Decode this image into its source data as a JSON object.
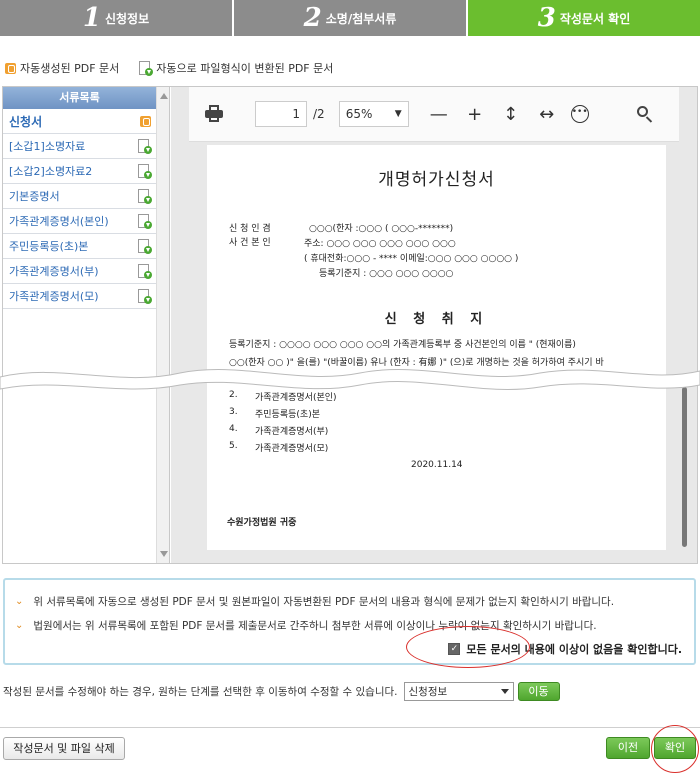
{
  "steps": [
    {
      "num": "1",
      "label": "신청정보"
    },
    {
      "num": "2",
      "label": "소명/첨부서류"
    },
    {
      "num": "3",
      "label": "작성문서 확인"
    }
  ],
  "legend": {
    "auto_pdf": "자동생성된 PDF 문서",
    "converted_pdf": "자동으로 파일형식이 변환된 PDF 문서"
  },
  "doclist": {
    "header": "서류목록",
    "items": [
      {
        "label": "신청서",
        "icon": "pdf-generated-icon"
      },
      {
        "label": "[소갑1]소명자료",
        "icon": "pdf-converted-icon"
      },
      {
        "label": "[소갑2]소명자료2",
        "icon": "pdf-converted-icon"
      },
      {
        "label": "기본증명서",
        "icon": "pdf-converted-icon"
      },
      {
        "label": "가족관계증명서(본인)",
        "icon": "pdf-converted-icon"
      },
      {
        "label": "주민등록등(초)본",
        "icon": "pdf-converted-icon"
      },
      {
        "label": "가족관계증명서(부)",
        "icon": "pdf-converted-icon"
      },
      {
        "label": "가족관계증명서(모)",
        "icon": "pdf-converted-icon"
      }
    ]
  },
  "viewer": {
    "page_current": "1",
    "page_total": "/2",
    "zoom": "65%",
    "doc": {
      "title": "개명허가신청서",
      "applicant_label1": "신 청 인 겸",
      "applicant_label2": "사 건 본 인",
      "line1": "○○○(한자 :○○○ ( ○○○-*******)",
      "line2": "주소: ○○○ ○○○ ○○○ ○○○ ○○○",
      "line3": "( 휴대전화:○○○ - ****   이메일:○○○ ○○○ ○○○○ )",
      "line4": "등록기준지 :  ○○○ ○○○ ○○○○",
      "subtitle": "신 청 취 지",
      "purpose1": "등록기준지 : ○○○○ ○○○ ○○○ ○○의 가족관계등록부 중 사건본인의 이름 \" (현재이름)",
      "purpose2": "○○(한자 ○○ )\" 을(를) \"(바꿀이름) 유나 (한자 : 有娜 )\" (으)로 개명하는 것을 허가하여 주시기 바",
      "list": [
        {
          "n": "2.",
          "t": "가족관계증명서(본인)"
        },
        {
          "n": "3.",
          "t": "주민등록등(초)본"
        },
        {
          "n": "4.",
          "t": "가족관계증명서(부)"
        },
        {
          "n": "5.",
          "t": "가족관계증명서(모)"
        }
      ],
      "date": "2020.11.14",
      "court": "수원가정법원 귀중"
    }
  },
  "notice": {
    "line1": "위 서류목록에 자동으로 생성된 PDF 문서 및 원본파일이 자동변환된 PDF 문서의 내용과 형식에 문제가 없는지 확인하시기 바랍니다.",
    "line2": "법원에서는 위 서류목록에 포함된 PDF 문서를 제출문서로 간주하니 첨부한 서류에 이상이나 누락이 없는지 확인하시기 바랍니다.",
    "agree": "모든 문서의 내용에 이상이 없음을 확인합니다."
  },
  "edit": {
    "text": "작성된 문서를 수정해야 하는 경우, 원하는 단계를 선택한 후 이동하여 수정할 수 있습니다.",
    "selected": "신청정보",
    "move": "이동"
  },
  "bottom": {
    "delete": "작성문서 및 파일 삭제",
    "prev": "이전",
    "ok": "확인"
  }
}
